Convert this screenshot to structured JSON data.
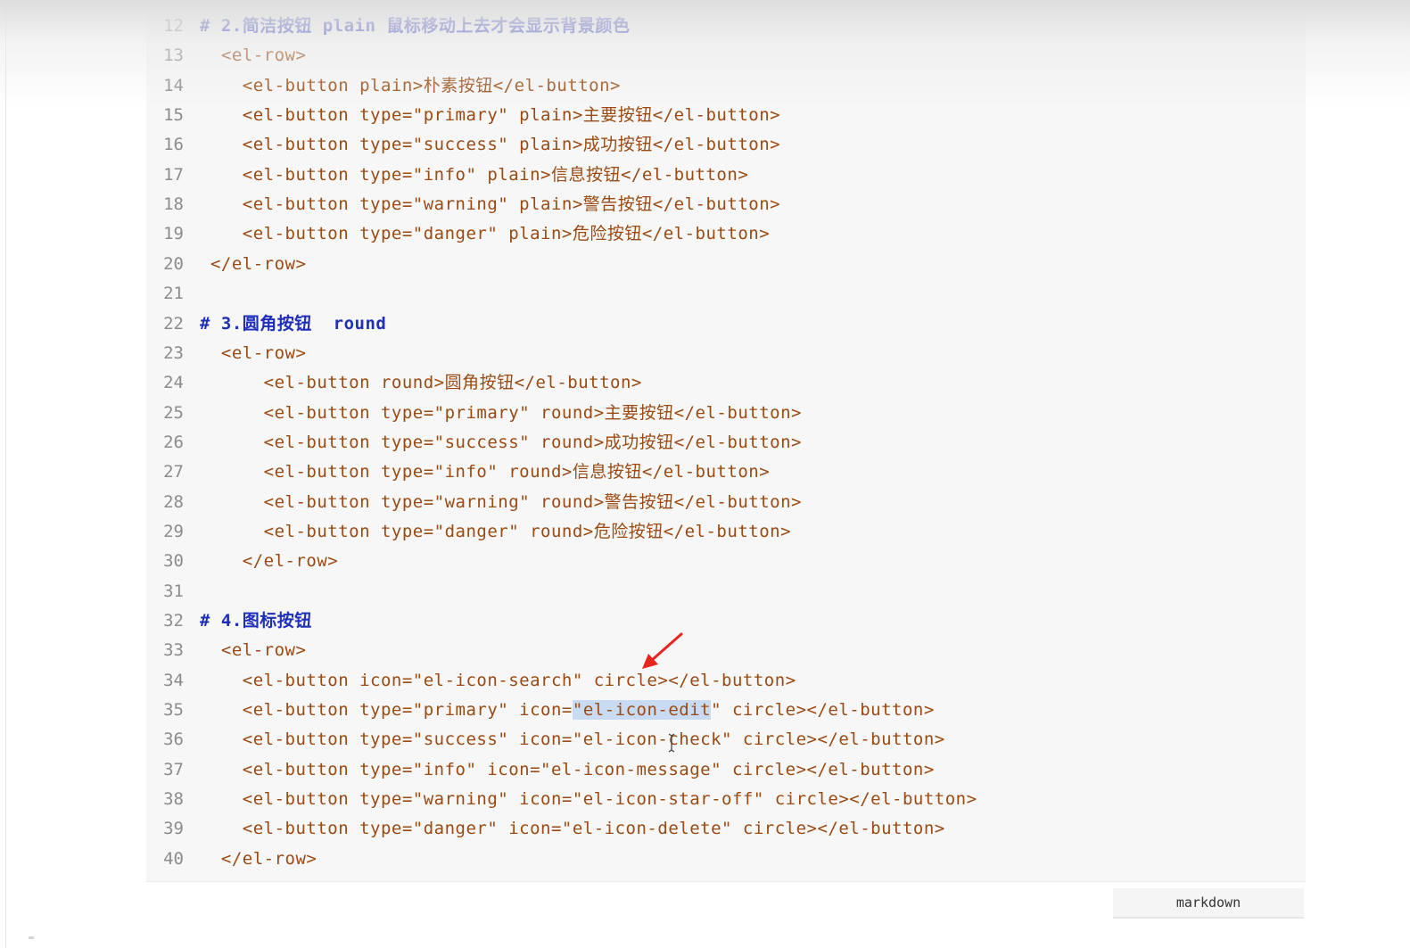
{
  "code_block": {
    "language_label": "markdown",
    "selected_text": "\"el-icon-edit",
    "lines": [
      {
        "n": "12",
        "text": "# 2.简洁按钮 plain 鼠标移动上去才会显示背景颜色",
        "kind": "comment"
      },
      {
        "n": "13",
        "text": "  <el-row>",
        "kind": "tag"
      },
      {
        "n": "14",
        "text": "    <el-button plain>朴素按钮</el-button>",
        "kind": "tag"
      },
      {
        "n": "15",
        "text": "    <el-button type=\"primary\" plain>主要按钮</el-button>",
        "kind": "tag"
      },
      {
        "n": "16",
        "text": "    <el-button type=\"success\" plain>成功按钮</el-button>",
        "kind": "tag"
      },
      {
        "n": "17",
        "text": "    <el-button type=\"info\" plain>信息按钮</el-button>",
        "kind": "tag"
      },
      {
        "n": "18",
        "text": "    <el-button type=\"warning\" plain>警告按钮</el-button>",
        "kind": "tag"
      },
      {
        "n": "19",
        "text": "    <el-button type=\"danger\" plain>危险按钮</el-button>",
        "kind": "tag"
      },
      {
        "n": "20",
        "text": " </el-row>",
        "kind": "tag"
      },
      {
        "n": "21",
        "text": "",
        "kind": "tag"
      },
      {
        "n": "22",
        "text": "# 3.圆角按钮  round",
        "kind": "comment"
      },
      {
        "n": "23",
        "text": "  <el-row>",
        "kind": "tag"
      },
      {
        "n": "24",
        "text": "      <el-button round>圆角按钮</el-button>",
        "kind": "tag"
      },
      {
        "n": "25",
        "text": "      <el-button type=\"primary\" round>主要按钮</el-button>",
        "kind": "tag"
      },
      {
        "n": "26",
        "text": "      <el-button type=\"success\" round>成功按钮</el-button>",
        "kind": "tag"
      },
      {
        "n": "27",
        "text": "      <el-button type=\"info\" round>信息按钮</el-button>",
        "kind": "tag"
      },
      {
        "n": "28",
        "text": "      <el-button type=\"warning\" round>警告按钮</el-button>",
        "kind": "tag"
      },
      {
        "n": "29",
        "text": "      <el-button type=\"danger\" round>危险按钮</el-button>",
        "kind": "tag"
      },
      {
        "n": "30",
        "text": "    </el-row>",
        "kind": "tag"
      },
      {
        "n": "31",
        "text": "",
        "kind": "tag"
      },
      {
        "n": "32",
        "text": "# 4.图标按钮",
        "kind": "comment"
      },
      {
        "n": "33",
        "text": "  <el-row>",
        "kind": "tag"
      },
      {
        "n": "34",
        "text": "    <el-button icon=\"el-icon-search\" circle></el-button>",
        "kind": "tag"
      },
      {
        "n": "35",
        "text": "    <el-button type=\"primary\" icon=\"el-icon-edit\" circle></el-button>",
        "kind": "tag",
        "selection": true
      },
      {
        "n": "36",
        "text": "    <el-button type=\"success\" icon=\"el-icon-check\" circle></el-button>",
        "kind": "tag"
      },
      {
        "n": "37",
        "text": "    <el-button type=\"info\" icon=\"el-icon-message\" circle></el-button>",
        "kind": "tag"
      },
      {
        "n": "38",
        "text": "    <el-button type=\"warning\" icon=\"el-icon-star-off\" circle></el-button>",
        "kind": "tag"
      },
      {
        "n": "39",
        "text": "    <el-button type=\"danger\" icon=\"el-icon-delete\" circle></el-button>",
        "kind": "tag"
      },
      {
        "n": "40",
        "text": "  </el-row>",
        "kind": "tag"
      }
    ]
  },
  "colors": {
    "comment": "#1f2fb8",
    "code": "#9a4a12",
    "selection": "#c9daf3",
    "annotation_arrow": "#e8261f"
  },
  "icons": {
    "annotation": "red-arrow-icon",
    "pointer": "text-cursor-icon"
  }
}
